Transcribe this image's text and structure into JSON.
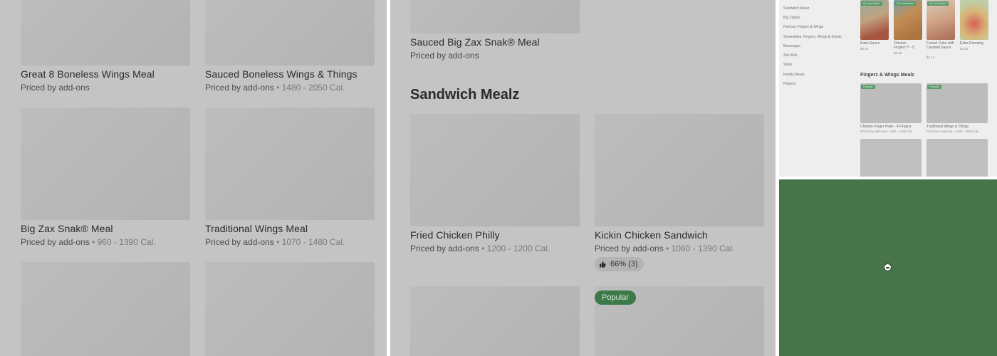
{
  "panel1": {
    "items": [
      {
        "title": "Great 8 Boneless Wings Meal",
        "price": "Priced by add-ons",
        "cal": ""
      },
      {
        "title": "Sauced Boneless Wings & Things",
        "price": "Priced by add-ons",
        "cal": " • 1480 - 2050 Cal."
      },
      {
        "title": "Big Zax Snak® Meal",
        "price": "Priced by add-ons",
        "cal": " • 960 - 1390 Cal."
      },
      {
        "title": "Traditional Wings Meal",
        "price": "Priced by add-ons",
        "cal": " • 1070 - 1480 Cal."
      }
    ]
  },
  "panel2": {
    "top_item": {
      "title": "Sauced Big Zax Snak® Meal",
      "price": "Priced by add-ons"
    },
    "section_heading": "Sandwich Mealz",
    "items": [
      {
        "title": "Fried Chicken Philly",
        "price": "Priced by add-ons",
        "cal": " • 1200 - 1200 Cal."
      },
      {
        "title": "Kickin Chicken Sandwich",
        "price": "Priced by add-ons",
        "cal": " • 1060 - 1390 Cal."
      }
    ],
    "rating": "66% (3)",
    "popular_badge": "Popular"
  },
  "panel3": {
    "sidebar": [
      "Sandwich Mealz",
      "Big Zalads",
      "Famous Fingerz & Wings",
      "Shareables: Fingerz, Wings & Extras",
      "Beverages",
      "Zax Kids",
      "Sides",
      "Family Meals",
      "Platters"
    ],
    "cards": [
      {
        "badge": "#1 most liked",
        "title": "Extra Sauce",
        "sub": "$0.32"
      },
      {
        "badge": "#2 most liked",
        "title": "Chicken Fingerz™ - 5",
        "sub": "$9.65"
      },
      {
        "badge": "#3 most liked",
        "title": "Funnel Cake with Caramel Sauce",
        "sub": "$4.13"
      },
      {
        "badge": "",
        "title": "Extra Dressing",
        "sub": "$0.32"
      }
    ],
    "heading": "Fingerz & Wings Mealz",
    "row2": [
      {
        "badge": "Popular",
        "title": "Chicken Finger Plate - 4 Fingerz",
        "sub": "Priced by add-ons • 1300 - 1620 Cal."
      },
      {
        "badge": "Popular",
        "title": "Traditional Wings & Things",
        "sub": "Priced by add-ons • 1480 - 2050 Cal."
      }
    ]
  },
  "colors": {
    "overlay_gray": "#c4c4c4",
    "popular_green": "#3c7a49",
    "map_green": "#477449"
  },
  "icons": {
    "thumbs_up": "thumbs-up-icon",
    "minus": "minus-circle-icon"
  }
}
